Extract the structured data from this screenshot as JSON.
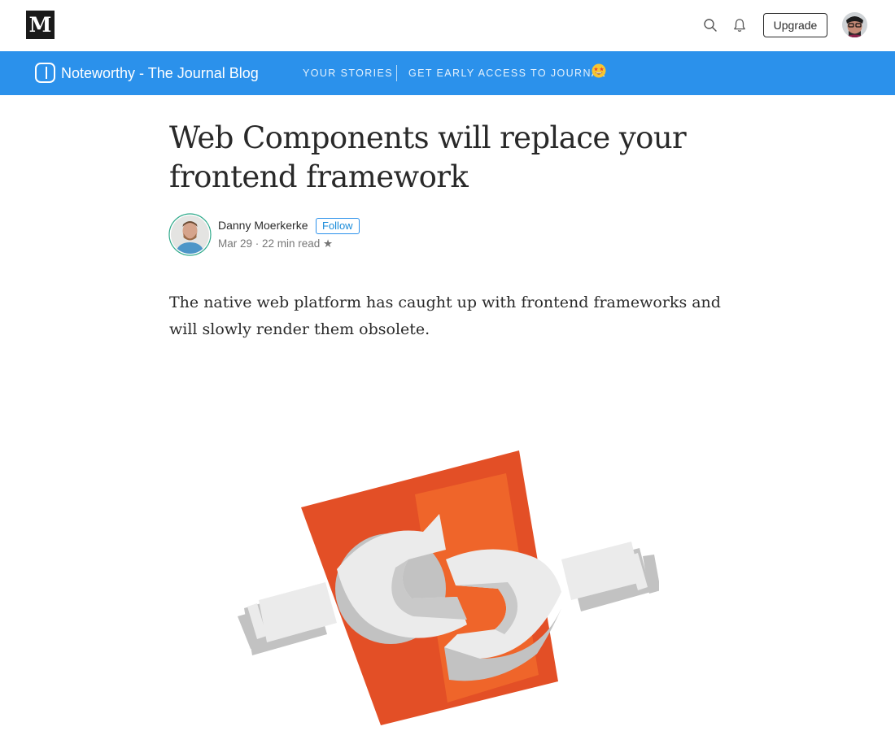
{
  "topbar": {
    "logo_letter": "M",
    "upgrade_label": "Upgrade",
    "icons": [
      "search-icon",
      "bell-icon"
    ]
  },
  "publication": {
    "name": "Noteworthy - The Journal Blog",
    "nav": [
      "YOUR STORIES",
      "GET EARLY ACCESS TO JOURNAL"
    ],
    "bar_color": "#2b91eb"
  },
  "article": {
    "title": "Web Components will replace your frontend framework",
    "author": "Danny Moerkerke",
    "follow_label": "Follow",
    "meta": "Mar 29 · 22 min read ★",
    "subtitle": "The native web platform has caught up with frontend frameworks and will slowly render them obsolete."
  },
  "colors": {
    "accent": "#2b91eb",
    "html5_orange": "#e34f26",
    "html5_light": "#ef652a",
    "wrench": "#ebebeb"
  }
}
